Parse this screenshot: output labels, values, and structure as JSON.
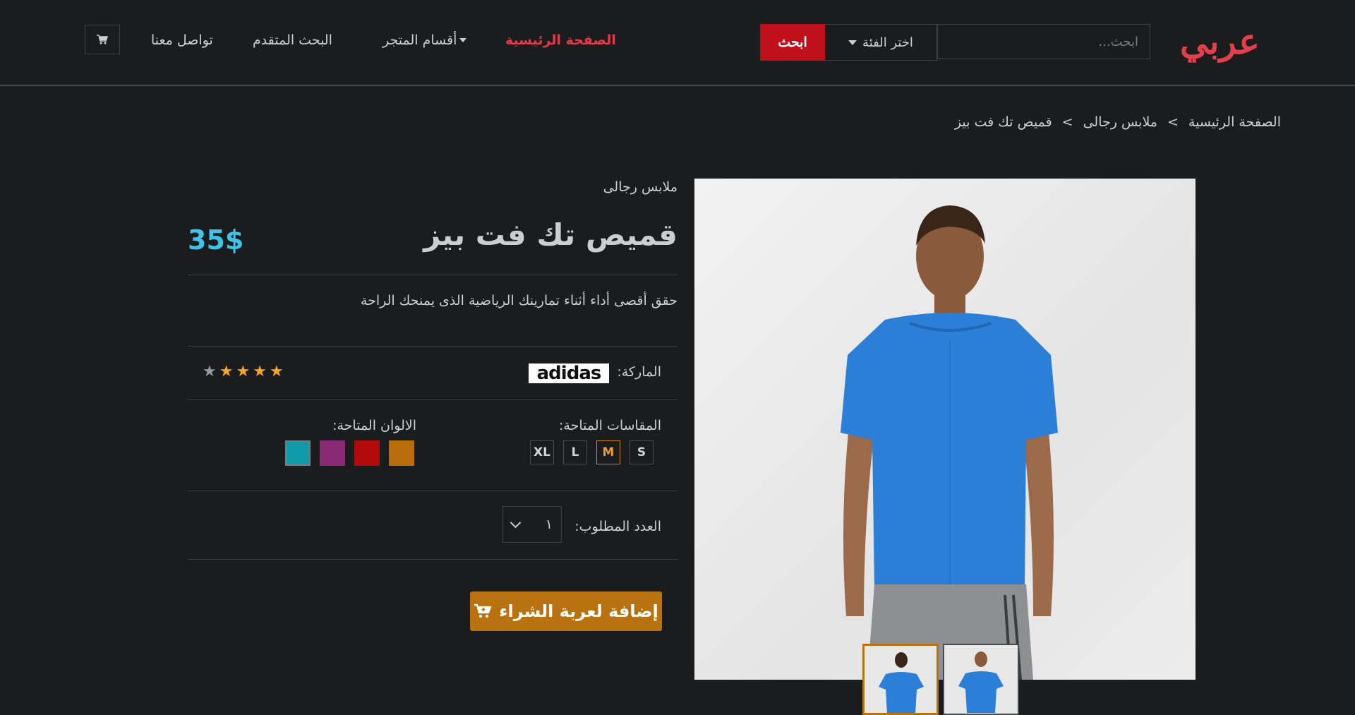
{
  "header": {
    "logo": "عربي",
    "search": {
      "placeholder": "ابحث...",
      "button": "ابحث",
      "category": "اختر الفئة"
    },
    "nav": {
      "home": "الصفحة الرئيسية",
      "departments": "أقسام المتجر",
      "advanced_search": "البحث المتقدم",
      "contact": "تواصل معنا"
    },
    "cart_icon": "cart-icon"
  },
  "breadcrumb": {
    "home": "الصفحة الرئيسية",
    "category": "ملابس رجالى",
    "current": "قميص تك فت بيز",
    "separator": ">"
  },
  "product": {
    "category": "ملابس رجالى",
    "title": "قميص تك فت بيز",
    "price": "35$",
    "description": "حقق أقصى أداء أثناء تمارينك الرياضية الذى يمنحك الراحة",
    "brand_label": "الماركة:",
    "brand_name": "adidas",
    "rating": 4,
    "rating_max": 5,
    "sizes_label": "المقاسات المتاحة:",
    "sizes": [
      "S",
      "M",
      "L",
      "XL"
    ],
    "selected_size": "M",
    "colors_label": "الالوان المتاحة:",
    "colors": [
      "#b86e0a",
      "#b30b0b",
      "#8b2a74",
      "#0e9aa8"
    ],
    "selected_color": "#0e9aa8",
    "quantity_label": "العدد المطلوب:",
    "quantity": "١",
    "add_to_cart": "إضافة لعربة الشراء",
    "colors_theme": {
      "accent": "#b8720f",
      "price": "#3fc4e8",
      "brand_red": "#e23f4b"
    }
  }
}
